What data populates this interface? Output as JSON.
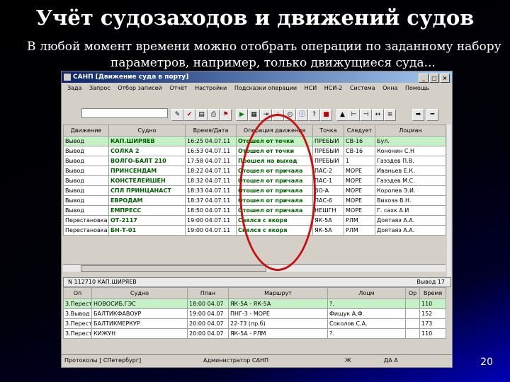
{
  "slide": {
    "title": "Учёт судозаходов и движений судов",
    "subtitle_line1": "В любой момент времени можно отобрать операции по заданному набору",
    "subtitle_line2": "параметров, например, только движущиеся суда...",
    "page_number": "20"
  },
  "window": {
    "title": "[Движение суда в порту]",
    "app_name": "САНП",
    "controls": [
      "_",
      "□",
      "×"
    ]
  },
  "menu": [
    "Зада",
    "Запрос",
    "Отбор записей",
    "Отчёт",
    "Настройки",
    "Подсказки операции",
    "НСИ",
    "НСИ-2",
    "Система",
    "Окна",
    "Помощь"
  ],
  "toolbar": {
    "input_value": "",
    "buttons": [
      {
        "icon": "edit-icon",
        "glyph": "✎",
        "color": "#000000"
      },
      {
        "icon": "check-icon",
        "glyph": "✔",
        "color": "#c00000"
      },
      {
        "icon": "page-icon",
        "glyph": "▤",
        "color": "#000000"
      },
      {
        "icon": "print-icon",
        "glyph": "⎙",
        "color": "#000000"
      },
      {
        "icon": "flag-red-icon",
        "glyph": "⚑",
        "color": "#c00000"
      },
      {
        "icon": "play-icon",
        "glyph": "▶",
        "color": "#008000"
      },
      {
        "icon": "grid-icon",
        "glyph": "▦",
        "color": "#000000"
      },
      {
        "icon": "export-icon",
        "glyph": "⇥",
        "color": "#000000"
      },
      {
        "icon": "warning-icon",
        "glyph": "⚠",
        "color": "#c08000"
      },
      {
        "icon": "clock-icon",
        "glyph": "◴",
        "color": "#000000"
      },
      {
        "icon": "info-icon",
        "glyph": "ⓘ",
        "color": "#000080"
      },
      {
        "icon": "help-icon",
        "glyph": "?",
        "color": "#000000"
      },
      {
        "icon": "stop-icon",
        "glyph": "■",
        "color": "#c00000"
      },
      {
        "icon": "sort-up-icon",
        "glyph": "▲",
        "color": "#000000"
      },
      {
        "icon": "tree-icon",
        "glyph": "⊢",
        "color": "#000000"
      },
      {
        "icon": "tree2-icon",
        "glyph": "⊣",
        "color": "#000000"
      },
      {
        "icon": "resize-icon",
        "glyph": "↔",
        "color": "#000000"
      },
      {
        "icon": "list-icon",
        "glyph": "≡",
        "color": "#000000"
      },
      {
        "icon": "arrow-right-icon",
        "glyph": "➡",
        "color": "#000000"
      },
      {
        "icon": "minus-icon",
        "glyph": "━",
        "color": "#000000"
      }
    ]
  },
  "movements": {
    "headers": [
      "Движение",
      "Судно",
      "Время/Дата",
      "Операция движения",
      "Точка",
      "Следует",
      "Лоцман"
    ],
    "rows": [
      [
        "Вывод",
        "КАП.ШИРЯЕВ",
        "16:25 04.07.11",
        "Отошел от точки",
        "ПРЕБЫИ",
        "СВ-16",
        "Бул."
      ],
      [
        "Вывод",
        "СОЛКА 2",
        "16:53 04.07.11",
        "Отошел от точки",
        "ПРЕБЫИ",
        "СВ-16",
        "Кононин С.Н"
      ],
      [
        "Вывод",
        "ВОЛГО-БАЛТ 210",
        "17:58 04.07.11",
        "Прошел на выход",
        "ПРЕБЫИ",
        "1",
        "Гаэздев П.В."
      ],
      [
        "Вывод",
        "ПРИНСЕНДАМ",
        "18:22 04.07.11",
        "Отошел от причала",
        "ПАС-2",
        "МОРЕ",
        "Иваньев Е.К."
      ],
      [
        "Вывод",
        "КОНСТЕЛЕЙШЕН",
        "18:32 04.07.11",
        "Отошел от причала",
        "ПАС-1",
        "МОРЕ",
        "Гаэздев М.С."
      ],
      [
        "Вывод",
        "СПЛ ПРИНЦАНАСТ",
        "18:33 04.07.11",
        "Отошел от причала",
        "ВО-А",
        "МОРЕ",
        "Королев Э.И."
      ],
      [
        "Вывод",
        "ЕВРОДАМ",
        "18:37 04.07.11",
        "Отошел от причала",
        "ПАС-6",
        "МОРЕ",
        "Вихоза В.Н."
      ],
      [
        "Вывод",
        "ЕМПРЕСС",
        "18:50 04.07.11",
        "Отошел от причала",
        "НЕШГН",
        "МОРЕ",
        "Г. сахк А.И"
      ],
      [
        "Перестановка",
        "ОТ-2117",
        "19:00 04.07.11",
        "Снялся с якоря",
        "ЯК-5А",
        "РЛМ",
        "Доятаяэ А.А."
      ],
      [
        "Перестановка",
        "БН-Т-01",
        "19:00 04.07.11",
        "Снялся с якоря",
        "ЯК-5А",
        "РЛМ",
        "Доятаяэ А.А."
      ]
    ]
  },
  "detail_status": "N 112710 КАП.ШИРЯЕВ",
  "detail_status_right": "Вывод 17",
  "details": {
    "headers": [
      "Оп",
      "Судно",
      "План",
      "Маршрут",
      "Лоцм",
      "Ор",
      "Время"
    ],
    "rows": [
      [
        "3.Перест",
        "НОВОСИБ.ГЭС",
        "18:00 04.07",
        "ЯК-5А - ЯК-5А",
        "?.",
        "",
        "110"
      ],
      [
        "3.Вывод",
        "БАЛТИКФАВОУР",
        "19:00 04.07",
        "ПНГ-3 - МОРЕ",
        "Фищук А.Ф.",
        "",
        "152"
      ],
      [
        "3.Перест",
        "БАЛТИКМЕРКУР",
        "20:00 04.07",
        "22-73 (пр.б)",
        "Соколов С.А.",
        "",
        "173"
      ],
      [
        "3.Перест",
        "КИЖУН",
        "20:00 04.07",
        "ЯК-5А - РЛМ",
        "?.",
        "",
        "110"
      ]
    ]
  },
  "statusbar": [
    "Протоколы [ СПетербург]",
    "Администратор САНП",
    "Ж",
    "ДА А"
  ]
}
